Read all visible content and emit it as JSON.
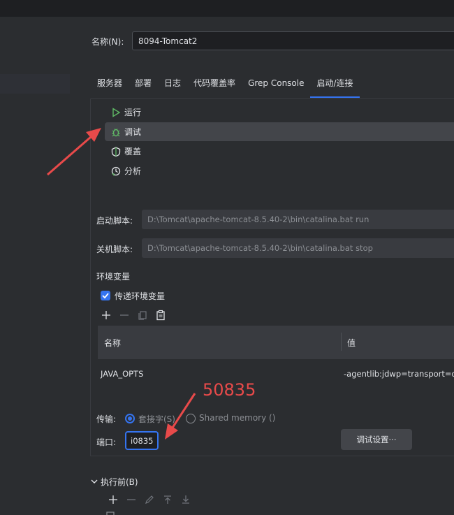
{
  "name": {
    "label": "名称(N):",
    "value": "8094-Tomcat2"
  },
  "tabs": [
    {
      "label": "服务器"
    },
    {
      "label": "部署"
    },
    {
      "label": "日志"
    },
    {
      "label": "代码覆盖率"
    },
    {
      "label": "Grep Console"
    },
    {
      "label": "启动/连接",
      "active": true
    }
  ],
  "executors": [
    {
      "label": "运行",
      "icon": "run-icon"
    },
    {
      "label": "调试",
      "icon": "debug-icon",
      "selected": true
    },
    {
      "label": "覆盖",
      "icon": "coverage-icon"
    },
    {
      "label": "分析",
      "icon": "profile-icon"
    }
  ],
  "startup": {
    "label": "启动脚本:",
    "value": "D:\\Tomcat\\apache-tomcat-8.5.40-2\\bin\\catalina.bat run"
  },
  "shutdown": {
    "label": "关机脚本:",
    "value": "D:\\Tomcat\\apache-tomcat-8.5.40-2\\bin\\catalina.bat stop"
  },
  "env": {
    "title": "环境变量",
    "pass_env_label": "传递环境变量",
    "pass_env_checked": true,
    "columns": {
      "name": "名称",
      "value": "值"
    },
    "rows": [
      {
        "name": "JAVA_OPTS",
        "value": "-agentlib:jdwp=transport=dt_"
      }
    ]
  },
  "transport": {
    "label": "传输:",
    "socket_label": "套接字(S)",
    "shared_label": "Shared memory ()",
    "selected": "socket"
  },
  "port": {
    "label": "端口:",
    "value": "i0835"
  },
  "debug_settings_label": "调试设置···",
  "before_launch": {
    "label": "执行前(B)"
  },
  "annotation": {
    "text": "50835",
    "color": "#e84a4a"
  },
  "colors": {
    "accent": "#3574f0",
    "background": "#2b2d30"
  }
}
